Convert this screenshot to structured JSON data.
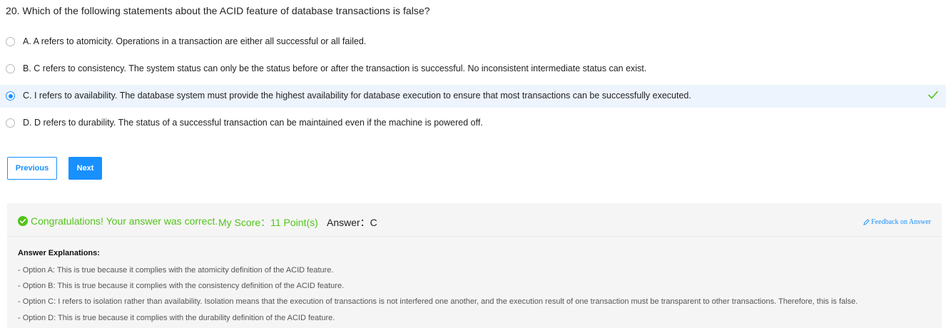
{
  "question": {
    "text": "20. Which of the following statements about the ACID feature of database transactions is false?"
  },
  "options": [
    {
      "text": "A. A refers to atomicity. Operations in a transaction are either all successful or all failed.",
      "selected": false
    },
    {
      "text": "B. C refers to consistency. The system status can only be the status before or after the transaction is successful. No inconsistent intermediate status can exist.",
      "selected": false
    },
    {
      "text": "C. I refers to availability. The database system must provide the highest availability for database execution to ensure that most transactions can be successfully executed.",
      "selected": true,
      "marked_correct": true
    },
    {
      "text": "D. D refers to durability. The status of a successful transaction can be maintained even if the machine is powered off.",
      "selected": false
    }
  ],
  "navigation": {
    "previous_label": "Previous",
    "next_label": "Next"
  },
  "result": {
    "congrats": "Congratulations! Your answer was correct.",
    "score": "My Score：11 Point(s)",
    "answer": "Answer：C",
    "feedback_link": "Feedback on Answer"
  },
  "explanation": {
    "title": "Answer Explanations:",
    "lines": [
      "- Option A: This is true because it complies with the atomicity definition of the ACID feature.",
      "- Option B: This is true because it complies with the consistency definition of the ACID feature.",
      "- Option C: I refers to isolation rather than availability. Isolation means that the execution of transactions is not interfered one another, and the execution result of one transaction must be transparent to other transactions. Therefore, this is false.",
      "- Option D: This is true because it complies with the durability definition of the ACID feature."
    ]
  },
  "colors": {
    "accent": "#1890ff",
    "success": "#52c41a",
    "selected_row_bg": "#edf4fd",
    "panel_bg": "#f5f5f5"
  },
  "icons": {
    "check": "check-icon",
    "success": "check-circle-icon",
    "feedback": "edit-icon"
  }
}
